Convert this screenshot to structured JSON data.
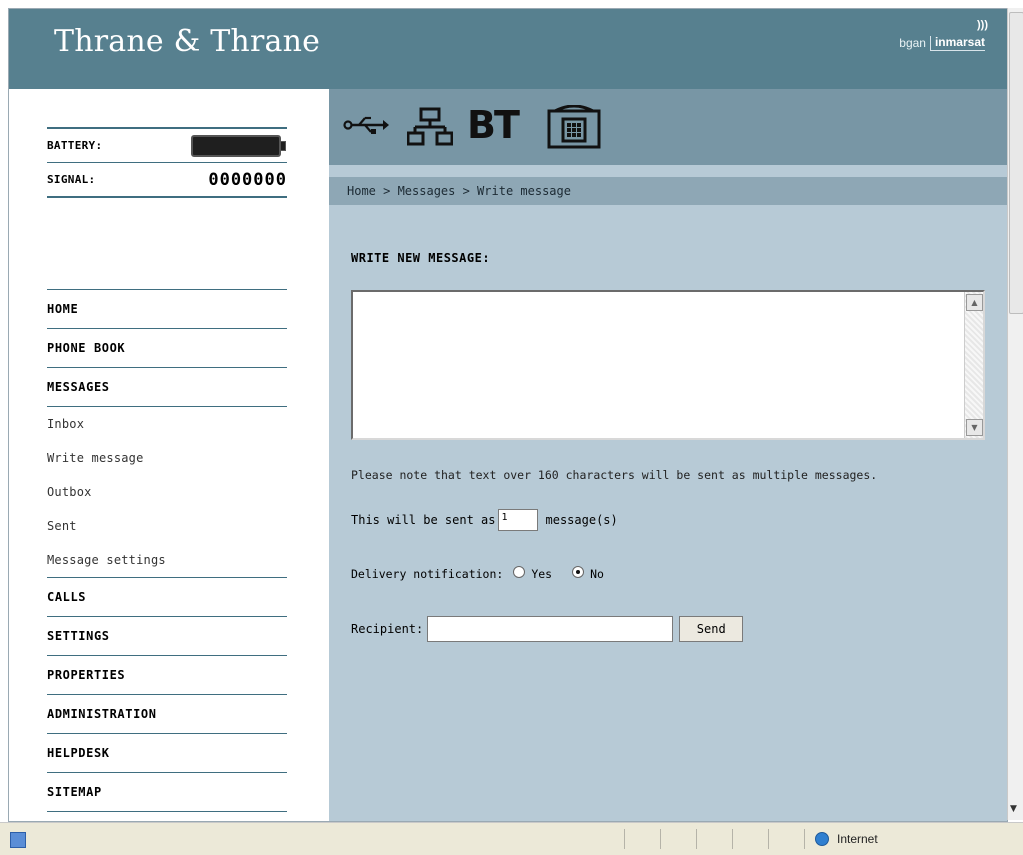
{
  "header": {
    "brand": "Thrane & Thrane",
    "logo_left": "bgan",
    "logo_right": "inmarsat"
  },
  "status": {
    "battery_label": "BATTERY:",
    "signal_label": "SIGNAL:",
    "signal_value": "0000000"
  },
  "nav": {
    "home": "HOME",
    "phone_book": "PHONE BOOK",
    "messages": "MESSAGES",
    "sub": {
      "inbox": "Inbox",
      "write": "Write message",
      "outbox": "Outbox",
      "sent": "Sent",
      "settings": "Message settings"
    },
    "calls": "CALLS",
    "settings": "SETTINGS",
    "properties": "PROPERTIES",
    "administration": "ADMINISTRATION",
    "helpdesk": "HELPDESK",
    "sitemap": "SITEMAP"
  },
  "iconbar": {
    "usb": "usb-icon",
    "lan": "network-icon",
    "bt": "BT",
    "phone": "phone-icon"
  },
  "breadcrumb": "Home > Messages > Write message",
  "form": {
    "heading": "WRITE NEW MESSAGE:",
    "message_value": "",
    "note": "Please note that text over 160 characters will be sent as multiple messages.",
    "sent_as_label": "This will be sent as",
    "sent_as_value": "1",
    "sent_as_suffix": "message(s)",
    "delivery_label": "Delivery notification:",
    "delivery_yes": "Yes",
    "delivery_no": "No",
    "delivery_selected": "No",
    "recipient_label": "Recipient:",
    "recipient_value": "",
    "send_label": "Send"
  },
  "browser_status": {
    "zone": "Internet"
  },
  "colors": {
    "header": "#57808f",
    "iconbar": "#7896a5",
    "breadcrumb_bar": "#8ea7b5",
    "content_bg": "#b7cad6",
    "nav_rule": "#3f6e80"
  }
}
